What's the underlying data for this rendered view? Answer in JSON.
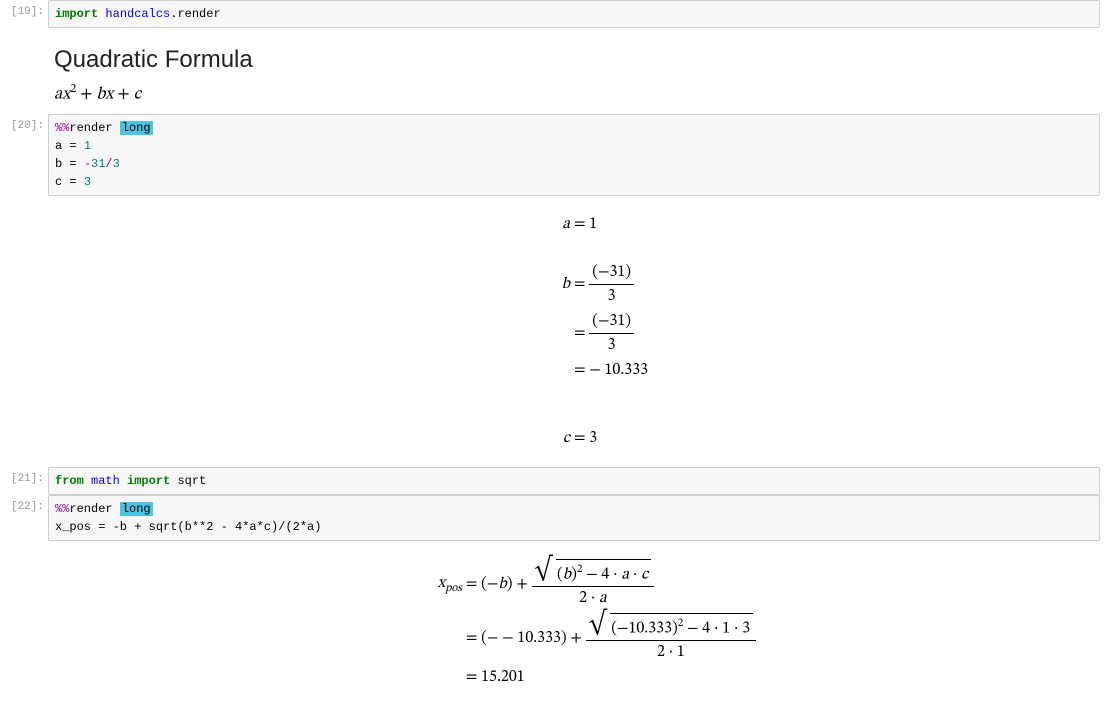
{
  "cells": {
    "c19": {
      "prompt": "[19]:",
      "code": {
        "import": "import",
        "mod1": "handcalcs",
        "dot": ".",
        "mod2": "render"
      }
    },
    "md": {
      "title": "Quadratic Formula",
      "expr_a": "a",
      "expr_x": "x",
      "expr_sup": "2",
      "expr_plus": " + ",
      "expr_b": "b",
      "expr_x2": "x",
      "expr_plus2": " + ",
      "expr_c": "c"
    },
    "c20": {
      "prompt": "[20]:",
      "code": {
        "magic_pct": "%%",
        "magic_name": "render",
        "space": " ",
        "magic_arg": "long",
        "line2_var": "a",
        "line2_eq": " = ",
        "line2_val": "1",
        "line3_var": "b",
        "line3_eq": " = ",
        "line3_neg": "-",
        "line3_num": "31",
        "line3_slash": "/",
        "line3_den": "3",
        "line4_var": "c",
        "line4_eq": " = ",
        "line4_val": "3"
      },
      "out": {
        "a_lhs": "a",
        "a_eq": " = ",
        "a_val": "1",
        "b_lhs": "b",
        "b_eq": " = ",
        "b_frac_num": "(−31)",
        "b_frac_den": "3",
        "b_eq2": "= ",
        "b_frac2_num": "(−31)",
        "b_frac2_den": "3",
        "b_eq3": "= ",
        "b_val": "− 10.333",
        "c_lhs": "c",
        "c_eq": " = ",
        "c_val": "3"
      }
    },
    "c21": {
      "prompt": "[21]:",
      "code": {
        "from": "from",
        "mod": "math",
        "import": "import",
        "name": "sqrt"
      }
    },
    "c22": {
      "prompt": "[22]:",
      "code": {
        "magic_pct": "%%",
        "magic_name": "render",
        "magic_arg": "long",
        "line2": "x_pos = -b + sqrt(b**2 - 4*a*c)/(2*a)"
      },
      "out": {
        "lhs_var": "x",
        "lhs_sub": "pos",
        "eq": " = ",
        "term1": "(−",
        "term1_b": "b",
        "term1_close": ") + ",
        "sq_open": "(",
        "sq_b": "b",
        "sq_close": ")",
        "sq_sup": "2",
        "sq_minus": " − 4 · ",
        "sq_a": "a",
        "sq_dot": " · ",
        "sq_c": "c",
        "den1": "2 · ",
        "den1_a": "a",
        "eq2": "= ",
        "term2": "(− − 10.333) + ",
        "sq2_inner": "(−10.333)",
        "sq2_sup": "2",
        "sq2_rest": " − 4 · 1 · 3",
        "den2": "2 · 1",
        "eq3": "= ",
        "val3": "15.201"
      }
    }
  }
}
